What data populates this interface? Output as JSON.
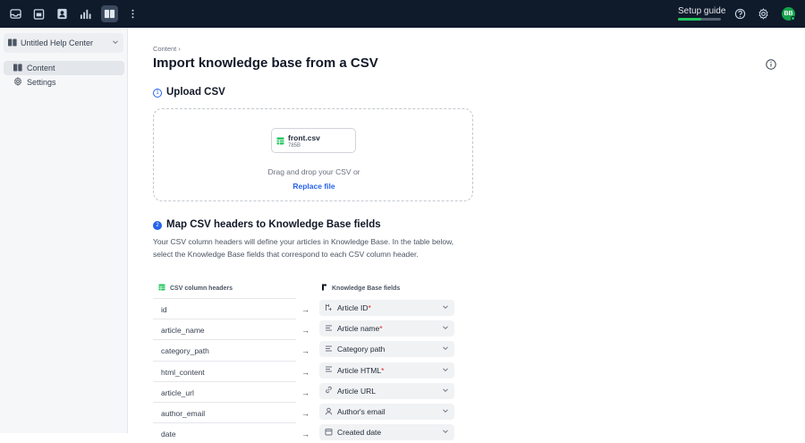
{
  "topbar": {
    "icons": [
      "inbox-icon",
      "calendar-icon",
      "contacts-icon",
      "analytics-icon",
      "knowledge-base-icon",
      "more-vertical-icon"
    ],
    "setup_label": "Setup guide",
    "setup_progress": 0.55,
    "avatar_initials": "BB",
    "accent": "#22c55e"
  },
  "sidebar": {
    "help_center": "Untitled Help Center",
    "items": [
      {
        "label": "Content",
        "icon": "book-icon",
        "active": true
      },
      {
        "label": "Settings",
        "icon": "gear-icon",
        "active": false
      }
    ]
  },
  "main": {
    "breadcrumb": "Content",
    "title": "Import knowledge base from a CSV",
    "step1": {
      "num": "1",
      "title": "Upload CSV"
    },
    "file": {
      "name": "front.csv",
      "size": "785B"
    },
    "drop_text": "Drag and drop your CSV or",
    "replace_label": "Replace file",
    "step2": {
      "num": "2",
      "title": "Map CSV headers to Knowledge Base fields",
      "description": "Your CSV column headers will define your articles in Knowledge Base. In the table below, select the Knowledge Base fields that correspond to each CSV column header."
    },
    "table": {
      "col1": "CSV column headers",
      "col2": "Knowledge Base fields",
      "rows": [
        {
          "csv": "id",
          "field": "Article ID",
          "required": true,
          "icon": "id-icon"
        },
        {
          "csv": "article_name",
          "field": "Article name",
          "required": true,
          "icon": "text-lines-icon"
        },
        {
          "csv": "category_path",
          "field": "Category path",
          "required": false,
          "icon": "text-lines-icon"
        },
        {
          "csv": "html_content",
          "field": "Article HTML",
          "required": true,
          "icon": "text-lines-icon"
        },
        {
          "csv": "article_url",
          "field": "Article URL",
          "required": false,
          "icon": "link-icon"
        },
        {
          "csv": "author_email",
          "field": "Author's email",
          "required": false,
          "icon": "person-icon"
        },
        {
          "csv": "date",
          "field": "Created date",
          "required": false,
          "icon": "calendar-icon"
        }
      ]
    }
  }
}
